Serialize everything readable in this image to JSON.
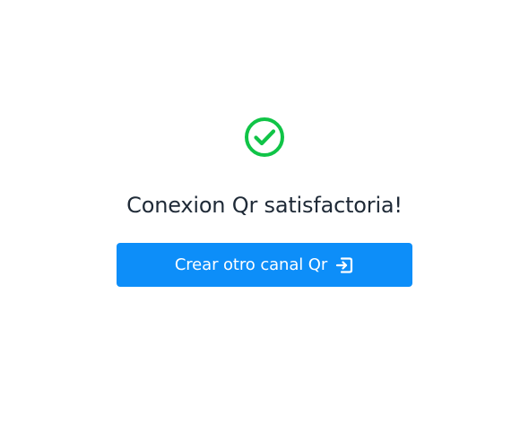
{
  "status": {
    "icon": "check-circle-icon",
    "title": "Conexion Qr satisfactoria!"
  },
  "action": {
    "label": "Crear otro canal Qr",
    "icon": "sign-in-icon"
  },
  "colors": {
    "success": "#10c447",
    "primary": "#0d8ef9",
    "title_text": "#1f2a37",
    "background": "#ffffff"
  }
}
